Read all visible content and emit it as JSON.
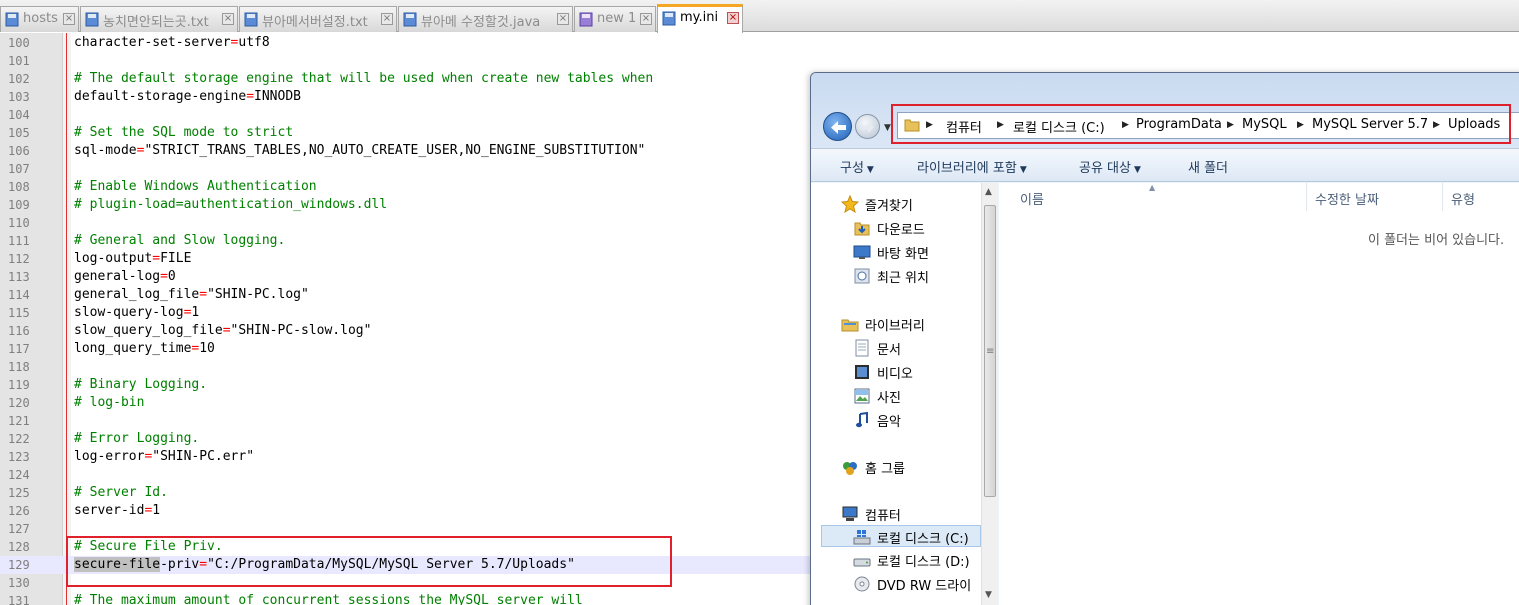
{
  "tabs": [
    {
      "label": "hosts",
      "active": false
    },
    {
      "label": "농치면안되는곳.txt",
      "active": false
    },
    {
      "label": "뷰아메서버설정.txt",
      "active": false
    },
    {
      "label": "뷰아메 수정할것.java",
      "active": false
    },
    {
      "label": "new 1",
      "active": false
    },
    {
      "label": "my.ini",
      "active": true
    }
  ],
  "editor": {
    "line_numbers": [
      "100",
      "101",
      "102",
      "103",
      "104",
      "105",
      "106",
      "107",
      "108",
      "109",
      "110",
      "111",
      "112",
      "113",
      "114",
      "115",
      "116",
      "117",
      "118",
      "119",
      "120",
      "121",
      "122",
      "123",
      "124",
      "125",
      "126",
      "127",
      "128",
      "129",
      "130",
      "131"
    ],
    "lines": {
      "l100_key": "character-set-server",
      "l100_eq": "=",
      "l100_val": "utf8",
      "l102": "# The default storage engine that will be used when create new tables when",
      "l103_key": "default-storage-engine",
      "l103_eq": "=",
      "l103_val": "INNODB",
      "l105": "# Set the SQL mode to strict",
      "l106_key": "sql-mode",
      "l106_eq": "=",
      "l106_val": "\"STRICT_TRANS_TABLES,NO_AUTO_CREATE_USER,NO_ENGINE_SUBSTITUTION\"",
      "l108": "# Enable Windows Authentication",
      "l109": "# plugin-load=authentication_windows.dll",
      "l111": "# General and Slow logging.",
      "l112_key": "log-output",
      "l112_eq": "=",
      "l112_val": "FILE",
      "l113_key": "general-log",
      "l113_eq": "=",
      "l113_val": "0",
      "l114_key": "general_log_file",
      "l114_eq": "=",
      "l114_val": "\"SHIN-PC.log\"",
      "l115_key": "slow-query-log",
      "l115_eq": "=",
      "l115_val": "1",
      "l116_key": "slow_query_log_file",
      "l116_eq": "=",
      "l116_val": "\"SHIN-PC-slow.log\"",
      "l117_key": "long_query_time",
      "l117_eq": "=",
      "l117_val": "10",
      "l119": "# Binary Logging.",
      "l120": "# log-bin",
      "l122": "# Error Logging.",
      "l123_key": "log-error",
      "l123_eq": "=",
      "l123_val": "\"SHIN-PC.err\"",
      "l125": "# Server Id.",
      "l126_key": "server-id",
      "l126_eq": "=",
      "l126_val": "1",
      "l128": "# Secure File Priv.",
      "l129_key_hl": "secure-file",
      "l129_key_rest": "-priv",
      "l129_eq": "=",
      "l129_val": "\"C:/ProgramData/MySQL/MySQL Server 5.7/Uploads\"",
      "l131": "# The maximum amount of concurrent sessions the MySQL server will"
    }
  },
  "explorer": {
    "breadcrumb": [
      "컴퓨터",
      "로컬 디스크 (C:)",
      "ProgramData",
      "MySQL",
      "MySQL Server 5.7",
      "Uploads"
    ],
    "toolbar": {
      "organize": "구성",
      "include_library": "라이브러리에 포함",
      "share": "공유 대상",
      "new_folder": "새 폴더"
    },
    "nav": {
      "favorites": "즐겨찾기",
      "downloads": "다운로드",
      "desktop": "바탕 화면",
      "recent": "최근 위치",
      "libraries": "라이브러리",
      "documents": "문서",
      "videos": "비디오",
      "pictures": "사진",
      "music": "음악",
      "homegroup": "홈 그룹",
      "computer": "컴퓨터",
      "local_c": "로컬 디스크 (C:)",
      "local_d": "로컬 디스크 (D:)",
      "dvd": "DVD RW 드라이"
    },
    "columns": {
      "name": "이름",
      "modified": "수정한 날짜",
      "type": "유형"
    },
    "empty_message": "이 폴더는 비어 있습니다."
  },
  "colors": {
    "annotation_red": "#e0202a",
    "comment_green": "#008000",
    "operator_red": "#ff0000"
  }
}
